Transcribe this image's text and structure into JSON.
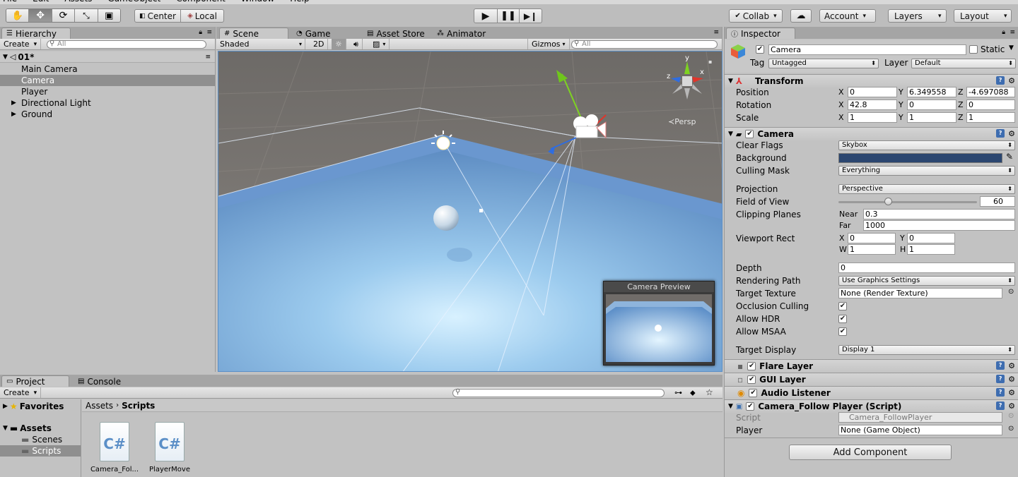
{
  "menu": {
    "items": [
      "File",
      "Edit",
      "Assets",
      "GameObject",
      "Component",
      "Window",
      "Help"
    ]
  },
  "toolbar": {
    "tools": [
      "hand-icon",
      "move-icon",
      "rotate-icon",
      "scale-icon",
      "rect-icon"
    ],
    "pivot": "Center",
    "space": "Local",
    "collab": "Collab",
    "account": "Account",
    "layers": "Layers",
    "layout": "Layout"
  },
  "hierarchy": {
    "tab": "Hierarchy",
    "create": "Create",
    "search_placeholder": "All",
    "scene": "01*",
    "items": [
      {
        "label": "Main Camera",
        "selected": false,
        "expandable": false
      },
      {
        "label": "Camera",
        "selected": true,
        "expandable": false
      },
      {
        "label": "Player",
        "selected": false,
        "expandable": false
      },
      {
        "label": "Directional Light",
        "selected": false,
        "expandable": true
      },
      {
        "label": "Ground",
        "selected": false,
        "expandable": true
      }
    ]
  },
  "scene_view": {
    "tabs": [
      "Scene",
      "Game",
      "Asset Store",
      "Animator"
    ],
    "shading": "Shaded",
    "mode_2d": "2D",
    "gizmos": "Gizmos",
    "search_placeholder": "All",
    "persp": "Persp",
    "gizmo_axes": {
      "x": "x",
      "y": "y",
      "z": "z"
    },
    "camera_preview": "Camera Preview"
  },
  "project": {
    "tabs": [
      "Project",
      "Console"
    ],
    "create": "Create",
    "favorites": "Favorites",
    "assets": "Assets",
    "folders": [
      {
        "label": "Scenes",
        "selected": false
      },
      {
        "label": "Scripts",
        "selected": true
      }
    ],
    "breadcrumb": [
      "Assets",
      "Scripts"
    ],
    "files": [
      "Camera_Fol...",
      "PlayerMove"
    ],
    "file_glyph": "C#"
  },
  "inspector": {
    "tab": "Inspector",
    "object_name": "Camera",
    "static_label": "Static",
    "tag_label": "Tag",
    "tag_value": "Untagged",
    "layer_label": "Layer",
    "layer_value": "Default",
    "transform": {
      "title": "Transform",
      "rows": [
        {
          "label": "Position",
          "x": "0",
          "y": "6.349558",
          "z": "-4.697088"
        },
        {
          "label": "Rotation",
          "x": "42.8",
          "y": "0",
          "z": "0"
        },
        {
          "label": "Scale",
          "x": "1",
          "y": "1",
          "z": "1"
        }
      ]
    },
    "camera": {
      "title": "Camera",
      "clear_flags_label": "Clear Flags",
      "clear_flags": "Skybox",
      "background_label": "Background",
      "background_color": "#2b4670",
      "culling_mask_label": "Culling Mask",
      "culling_mask": "Everything",
      "projection_label": "Projection",
      "projection": "Perspective",
      "fov_label": "Field of View",
      "fov": "60",
      "fov_fraction": 0.33,
      "clipping_label": "Clipping Planes",
      "near_label": "Near",
      "near": "0.3",
      "far_label": "Far",
      "far": "1000",
      "viewport_label": "Viewport Rect",
      "vx": "0",
      "vy": "0",
      "vw": "1",
      "vh": "1",
      "depth_label": "Depth",
      "depth": "0",
      "rendering_path_label": "Rendering Path",
      "rendering_path": "Use Graphics Settings",
      "target_texture_label": "Target Texture",
      "target_texture": "None (Render Texture)",
      "occlusion_label": "Occlusion Culling",
      "hdr_label": "Allow HDR",
      "msaa_label": "Allow MSAA",
      "target_display_label": "Target Display",
      "target_display": "Display 1"
    },
    "components": [
      "Flare Layer",
      "GUI Layer",
      "Audio Listener"
    ],
    "script": {
      "title": "Camera_Follow Player (Script)",
      "script_label": "Script",
      "script_value": "Camera_FollowPlayer",
      "player_label": "Player",
      "player_value": "None (Game Object)"
    },
    "add_component": "Add Component"
  }
}
